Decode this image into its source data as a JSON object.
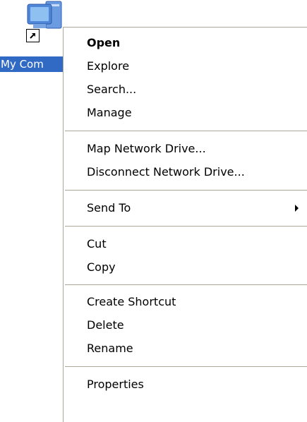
{
  "desktop_icon": {
    "label": "My Com",
    "icon": "my-computer-icon",
    "overlay_icon": "shortcut-arrow-icon"
  },
  "context_menu": {
    "items": [
      {
        "label": "Open",
        "default": true
      },
      {
        "label": "Explore"
      },
      {
        "label": "Search..."
      },
      {
        "label": "Manage"
      },
      {
        "label": "Map Network Drive..."
      },
      {
        "label": "Disconnect Network Drive..."
      },
      {
        "label": "Send To",
        "submenu": true,
        "icon": "submenu-arrow-icon"
      },
      {
        "label": "Cut"
      },
      {
        "label": "Copy"
      },
      {
        "label": "Create Shortcut"
      },
      {
        "label": "Delete"
      },
      {
        "label": "Rename"
      },
      {
        "label": "Properties"
      }
    ]
  },
  "colors": {
    "selection_highlight": "#316ac5",
    "separator": "#aca899",
    "menu_background": "#ffffff"
  }
}
